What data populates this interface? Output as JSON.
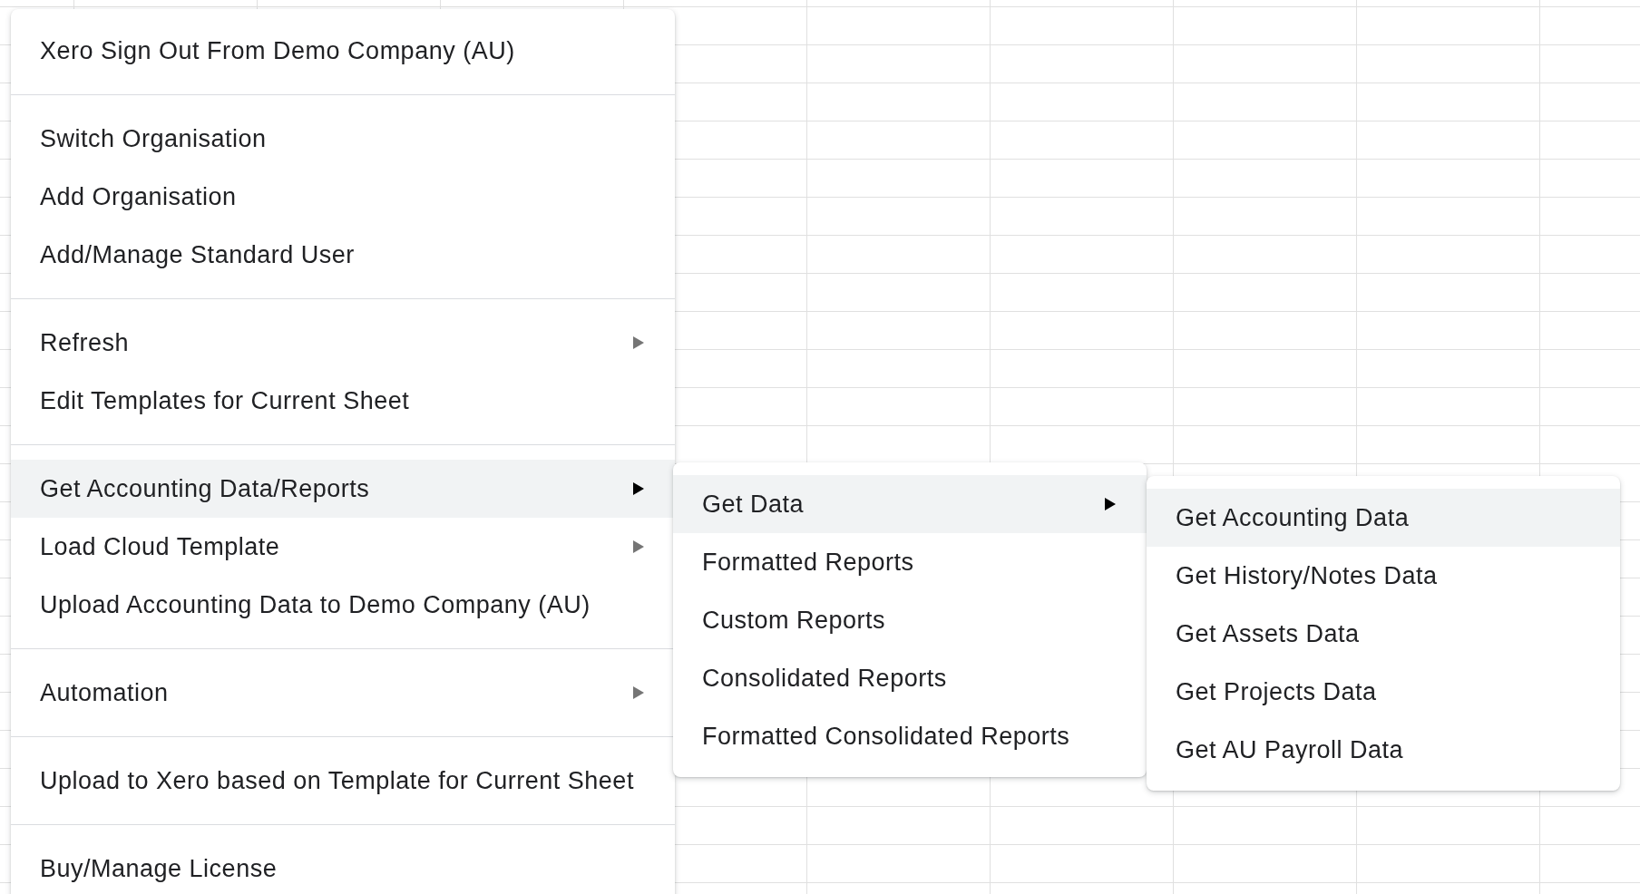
{
  "main_menu": {
    "sections": [
      {
        "items": [
          {
            "label": "Xero Sign Out From Demo Company (AU)",
            "has_submenu": false,
            "selected": false
          }
        ]
      },
      {
        "items": [
          {
            "label": "Switch Organisation",
            "has_submenu": false,
            "selected": false
          },
          {
            "label": "Add Organisation",
            "has_submenu": false,
            "selected": false
          },
          {
            "label": "Add/Manage Standard User",
            "has_submenu": false,
            "selected": false
          }
        ]
      },
      {
        "items": [
          {
            "label": "Refresh",
            "has_submenu": true,
            "selected": false
          },
          {
            "label": "Edit Templates for Current Sheet",
            "has_submenu": false,
            "selected": false
          }
        ]
      },
      {
        "items": [
          {
            "label": "Get Accounting Data/Reports",
            "has_submenu": true,
            "selected": true
          },
          {
            "label": "Load Cloud Template",
            "has_submenu": true,
            "selected": false
          },
          {
            "label": "Upload Accounting Data to Demo Company (AU)",
            "has_submenu": false,
            "selected": false
          }
        ]
      },
      {
        "items": [
          {
            "label": "Automation",
            "has_submenu": true,
            "selected": false
          }
        ]
      },
      {
        "items": [
          {
            "label": "Upload to Xero based on Template for Current Sheet",
            "has_submenu": false,
            "selected": false
          }
        ]
      },
      {
        "items": [
          {
            "label": "Buy/Manage License",
            "has_submenu": false,
            "selected": false
          }
        ]
      }
    ]
  },
  "submenu": {
    "items": [
      {
        "label": "Get Data",
        "has_submenu": true,
        "selected": true
      },
      {
        "label": "Formatted Reports",
        "has_submenu": false,
        "selected": false
      },
      {
        "label": "Custom Reports",
        "has_submenu": false,
        "selected": false
      },
      {
        "label": "Consolidated Reports",
        "has_submenu": false,
        "selected": false
      },
      {
        "label": "Formatted Consolidated Reports",
        "has_submenu": false,
        "selected": false
      }
    ]
  },
  "nested_submenu": {
    "items": [
      {
        "label": "Get Accounting Data",
        "has_submenu": false,
        "selected": true
      },
      {
        "label": "Get History/Notes Data",
        "has_submenu": false,
        "selected": false
      },
      {
        "label": "Get Assets Data",
        "has_submenu": false,
        "selected": false
      },
      {
        "label": "Get Projects Data",
        "has_submenu": false,
        "selected": false
      },
      {
        "label": "Get AU Payroll Data",
        "has_submenu": false,
        "selected": false
      }
    ]
  }
}
